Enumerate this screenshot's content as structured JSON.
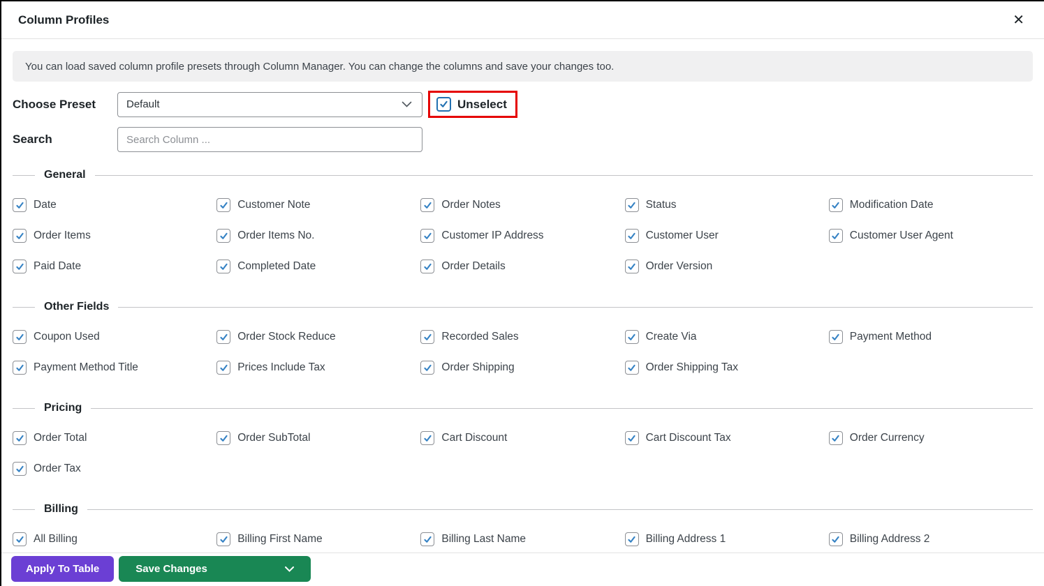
{
  "modal": {
    "title": "Column Profiles",
    "close_icon": "✕"
  },
  "banner": {
    "text": "You can load saved column profile presets through Column Manager. You can change the columns and save your changes too."
  },
  "preset": {
    "label": "Choose Preset",
    "selected_option": "Default",
    "unselect_label": "Unselect",
    "unselect_checked": true
  },
  "search": {
    "label": "Search",
    "placeholder": "Search Column ..."
  },
  "sections": [
    {
      "title": "General",
      "items": [
        {
          "label": "Date",
          "checked": true
        },
        {
          "label": "Customer Note",
          "checked": true
        },
        {
          "label": "Order Notes",
          "checked": true
        },
        {
          "label": "Status",
          "checked": true
        },
        {
          "label": "Modification Date",
          "checked": true
        },
        {
          "label": "Order Items",
          "checked": true
        },
        {
          "label": "Order Items No.",
          "checked": true
        },
        {
          "label": "Customer IP Address",
          "checked": true
        },
        {
          "label": "Customer User",
          "checked": true
        },
        {
          "label": "Customer User Agent",
          "checked": true
        },
        {
          "label": "Paid Date",
          "checked": true
        },
        {
          "label": "Completed Date",
          "checked": true
        },
        {
          "label": "Order Details",
          "checked": true
        },
        {
          "label": "Order Version",
          "checked": true
        }
      ]
    },
    {
      "title": "Other Fields",
      "items": [
        {
          "label": "Coupon Used",
          "checked": true
        },
        {
          "label": "Order Stock Reduce",
          "checked": true
        },
        {
          "label": "Recorded Sales",
          "checked": true
        },
        {
          "label": "Create Via",
          "checked": true
        },
        {
          "label": "Payment Method",
          "checked": true
        },
        {
          "label": "Payment Method Title",
          "checked": true
        },
        {
          "label": "Prices Include Tax",
          "checked": true
        },
        {
          "label": "Order Shipping",
          "checked": true
        },
        {
          "label": "Order Shipping Tax",
          "checked": true
        }
      ]
    },
    {
      "title": "Pricing",
      "items": [
        {
          "label": "Order Total",
          "checked": true
        },
        {
          "label": "Order SubTotal",
          "checked": true
        },
        {
          "label": "Cart Discount",
          "checked": true
        },
        {
          "label": "Cart Discount Tax",
          "checked": true
        },
        {
          "label": "Order Currency",
          "checked": true
        },
        {
          "label": "Order Tax",
          "checked": true
        }
      ]
    },
    {
      "title": "Billing",
      "items": [
        {
          "label": "All Billing",
          "checked": true
        },
        {
          "label": "Billing First Name",
          "checked": true
        },
        {
          "label": "Billing Last Name",
          "checked": true
        },
        {
          "label": "Billing Address 1",
          "checked": true
        },
        {
          "label": "Billing Address 2",
          "checked": true
        }
      ]
    }
  ],
  "footer": {
    "apply_label": "Apply To Table",
    "save_label": "Save Changes"
  },
  "colors": {
    "check": "#3582c4",
    "apply_button": "#6b3fd4",
    "save_button": "#198754",
    "highlight": "#e50000"
  }
}
